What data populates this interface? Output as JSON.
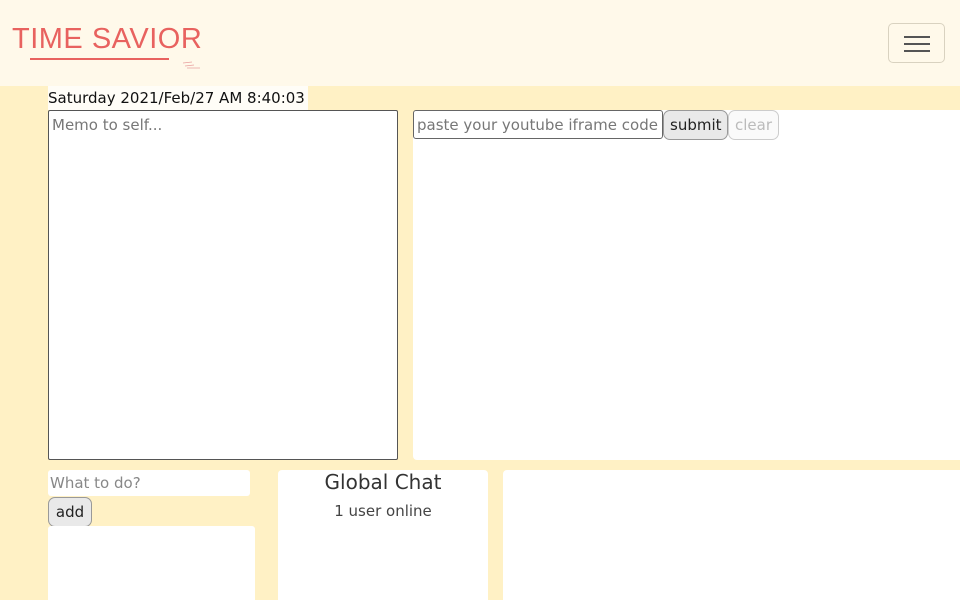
{
  "header": {
    "brand": "TIME SAVIOR",
    "brand_color": "#e8625f",
    "menu_icon": "hamburger-menu-icon"
  },
  "datetime": "Saturday 2021/Feb/27 AM 8:40:03",
  "memo": {
    "placeholder": "Memo to self...",
    "value": ""
  },
  "video": {
    "input_placeholder": "paste your youtube iframe code",
    "submit_label": "submit",
    "clear_label": "clear"
  },
  "todo": {
    "input_placeholder": "What to do?",
    "add_label": "add",
    "items": []
  },
  "chat": {
    "title": "Global Chat",
    "users_online": "1 user online"
  },
  "colors": {
    "page_background": "#fff1c5",
    "header_background": "#fff9ea",
    "panel_background": "#ffffff"
  }
}
